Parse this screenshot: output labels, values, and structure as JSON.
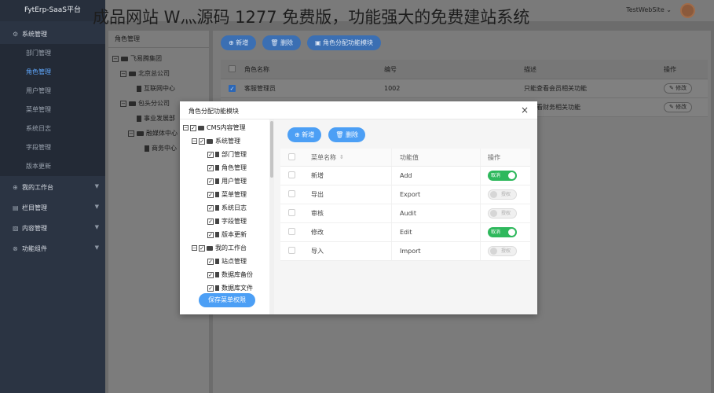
{
  "app": {
    "brand": "FytErp-SaaS平台"
  },
  "watermark": "成品网站 W灬源码 1277 免费版，功能强大的免费建站系统",
  "topbar": {
    "site": "TestWebSite",
    "caret": "⌄"
  },
  "sidebar": {
    "groups": [
      {
        "label": "系统管理",
        "icon": "⚙",
        "expanded": true,
        "items": [
          "部门管理",
          "角色管理",
          "用户管理",
          "菜单管理",
          "系统日志",
          "字段管理",
          "版本更新"
        ]
      },
      {
        "label": "我的工作台",
        "icon": "⊕"
      },
      {
        "label": "栏目管理",
        "icon": "▤"
      },
      {
        "label": "内容管理",
        "icon": "▨"
      },
      {
        "label": "功能组件",
        "icon": "⊗"
      }
    ]
  },
  "left_panel": {
    "title": "角色管理",
    "tree": [
      {
        "label": "飞易腾集团",
        "level": 0,
        "toggle": "−",
        "type": "folder"
      },
      {
        "label": "北京总公司",
        "level": 1,
        "toggle": "−",
        "type": "folder"
      },
      {
        "label": "互联网中心",
        "level": 2,
        "type": "doc"
      },
      {
        "label": "包头分公司",
        "level": 1,
        "toggle": "−",
        "type": "folder"
      },
      {
        "label": "事业发展部",
        "level": 2,
        "type": "doc"
      },
      {
        "label": "融媒体中心",
        "level": 2,
        "toggle": "−",
        "type": "folder"
      },
      {
        "label": "商务中心",
        "level": 3,
        "type": "doc"
      }
    ]
  },
  "main": {
    "buttons": {
      "add": "⊕ 新增",
      "delete": "🗑 删除",
      "assign": "▣ 角色分配功能模块"
    },
    "columns": [
      "角色名称",
      "编号",
      "描述",
      "操作"
    ],
    "rows": [
      {
        "name": "客服管理员",
        "code": "1002",
        "desc": "只能查看会员相关功能",
        "action": "✎ 修改",
        "checked": true
      },
      {
        "name": "",
        "code": "",
        "desc": "能查看财务相关功能",
        "action": "✎ 修改",
        "checked": false
      }
    ]
  },
  "modal": {
    "title": "角色分配功能模块",
    "close": "×",
    "tree": [
      {
        "label": "CMS内容管理",
        "level": 0,
        "toggle": "−",
        "type": "folder"
      },
      {
        "label": "系统管理",
        "level": 1,
        "toggle": "−",
        "type": "folder"
      },
      {
        "label": "部门管理",
        "level": 2,
        "type": "doc"
      },
      {
        "label": "角色管理",
        "level": 2,
        "type": "doc"
      },
      {
        "label": "用户管理",
        "level": 2,
        "type": "doc"
      },
      {
        "label": "菜单管理",
        "level": 2,
        "type": "doc"
      },
      {
        "label": "系统日志",
        "level": 2,
        "type": "doc"
      },
      {
        "label": "字段管理",
        "level": 2,
        "type": "doc"
      },
      {
        "label": "版本更新",
        "level": 2,
        "type": "doc"
      },
      {
        "label": "我的工作台",
        "level": 1,
        "toggle": "−",
        "type": "folder"
      },
      {
        "label": "站点管理",
        "level": 2,
        "type": "doc"
      },
      {
        "label": "数据库备份",
        "level": 2,
        "type": "doc"
      },
      {
        "label": "数据库文件",
        "level": 2,
        "type": "doc"
      }
    ],
    "save_label": "保存菜单权限",
    "buttons": {
      "add": "⊕ 新增",
      "delete": "🗑 删除"
    },
    "columns": [
      "菜单名称",
      "功能值",
      "操作"
    ],
    "rows": [
      {
        "name": "新增",
        "value": "Add",
        "state": "on",
        "toggle_label": "取消"
      },
      {
        "name": "导出",
        "value": "Export",
        "state": "off",
        "toggle_label": "授权"
      },
      {
        "name": "审核",
        "value": "Audit",
        "state": "off",
        "toggle_label": "授权"
      },
      {
        "name": "修改",
        "value": "Edit",
        "state": "on",
        "toggle_label": "取消"
      },
      {
        "name": "导入",
        "value": "Import",
        "state": "off",
        "toggle_label": "授权"
      }
    ]
  }
}
